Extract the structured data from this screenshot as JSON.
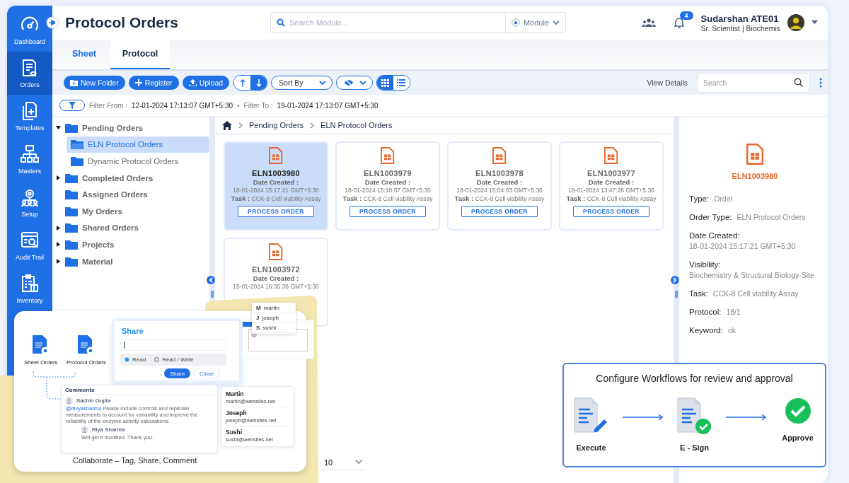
{
  "nav": [
    {
      "label": "Dashboard",
      "selected": false
    },
    {
      "label": "Orders",
      "selected": true
    },
    {
      "label": "Templates",
      "selected": false
    },
    {
      "label": "Masters",
      "selected": false
    },
    {
      "label": "Setup",
      "selected": false
    },
    {
      "label": "Audit Trail",
      "selected": false
    },
    {
      "label": "Inventory",
      "selected": false
    }
  ],
  "header": {
    "title": "Protocol Orders",
    "search": {
      "placeholder": "Search Module..."
    },
    "module": "Module",
    "notifications": "4",
    "user": {
      "name": "Sudarshan ATE01",
      "role": "Sr. Scientist | Biochemis"
    }
  },
  "tabs": [
    {
      "label": "Sheet",
      "selected": false
    },
    {
      "label": "Protocol",
      "selected": true
    }
  ],
  "toolbar": {
    "buttons": [
      {
        "label": "New Folder",
        "kind": "folder"
      },
      {
        "label": "Register",
        "kind": "plus"
      },
      {
        "label": "Upload",
        "kind": "upload"
      }
    ],
    "sort": "Sort By",
    "view_modes": [
      {
        "kind": "grid",
        "selected": true
      },
      {
        "kind": "list",
        "selected": false
      }
    ],
    "view_details": "View Details",
    "search": {
      "placeholder": "Search"
    }
  },
  "filter": {
    "from_label": "Filter From :",
    "from": "12-01-2024 17:13:07 GMT+5:30",
    "separator": "•",
    "to_label": "Filter To :",
    "to": "19-01-2024 17:13:07 GMT+5:30"
  },
  "tree": [
    {
      "label": "Pending Orders",
      "kind": "group",
      "expanded": true,
      "selected": false,
      "children": [
        {
          "label": "ELN Protocol Orders",
          "selected": true
        },
        {
          "label": "Dynamic Protocol Orders",
          "selected": false
        }
      ]
    },
    {
      "label": "Completed Orders",
      "kind": "group",
      "expanded": false,
      "selected": false
    },
    {
      "label": "Assigned Orders",
      "kind": "folder",
      "selected": false
    },
    {
      "label": "My Orders",
      "kind": "folder",
      "selected": false
    },
    {
      "label": "Shared Orders",
      "kind": "group",
      "expanded": false,
      "selected": false
    },
    {
      "label": "Projects",
      "kind": "group",
      "expanded": false,
      "selected": false
    },
    {
      "label": "Material",
      "kind": "group",
      "expanded": false,
      "selected": false
    }
  ],
  "breadcrumb": [
    "Pending Orders",
    "ELN Protocol Orders"
  ],
  "cards": [
    {
      "id": "ELN1003980",
      "date_label": "Date Created :",
      "date": "18-01-2024 15:17:21 GMT+5:30",
      "task_label": "Task :",
      "task": "CCK-8 Cell viability Assay",
      "action": "PROCESS ORDER",
      "selected": true
    },
    {
      "id": "ELN1003979",
      "date_label": "Date Created :",
      "date": "18-01-2024 15:10:57 GMT+5:30",
      "task_label": "Task :",
      "task": "CCK-8 Cell viability Assay",
      "action": "PROCESS ORDER",
      "selected": false
    },
    {
      "id": "ELN1003978",
      "date_label": "Date Created :",
      "date": "18-01-2024 15:04:03 GMT+5:30",
      "task_label": "Task :",
      "task": "CCK-8 Cell viability Assay",
      "action": "PROCESS ORDER",
      "selected": false
    },
    {
      "id": "ELN1003977",
      "date_label": "Date Created :",
      "date": "18-01-2024 13:47:26 GMT+5:30",
      "task_label": "Task :",
      "task": "CCK-8 Cell viability Assay",
      "action": "PROCESS ORDER",
      "selected": false
    },
    {
      "id": "ELN1003972",
      "date_label": "Date Created :",
      "date": "15-01-2024 16:35:36 GMT+5:30",
      "selected": false
    }
  ],
  "pager": {
    "page_size": "10"
  },
  "details": {
    "id": "ELN1003980",
    "fields": [
      {
        "label": "Type:",
        "value": "Order",
        "kind": "inline"
      },
      {
        "label": "Order Type:",
        "value": "ELN Protocol Orders",
        "kind": "inline"
      },
      {
        "label": "Date Created:",
        "value": "18-01-2024 15:17:21 GMT+5:30",
        "kind": "stacked"
      },
      {
        "label": "Visibility:",
        "value": "Biochemistry & Structural Biology-Site",
        "kind": "stacked"
      },
      {
        "label": "Task:",
        "value": "CCK-8 Cell viability Assay",
        "kind": "inline"
      },
      {
        "label": "Protocol:",
        "value": "18/1",
        "kind": "inline"
      },
      {
        "label": "Keyword:",
        "value": "ok",
        "kind": "inline"
      }
    ]
  },
  "collaborate": {
    "files": [
      "Sheet Orders",
      "Protocol Orders"
    ],
    "share": {
      "title": "Share",
      "options": [
        {
          "label": "Read",
          "selected": true
        },
        {
          "label": "Read / Write",
          "selected": false
        }
      ],
      "buttons": [
        "Share",
        "Close"
      ]
    },
    "editor_text": "@",
    "mentions": [
      {
        "initial": "M",
        "name": "martin"
      },
      {
        "initial": "J",
        "name": "joseph"
      },
      {
        "initial": "S",
        "name": "sushi"
      }
    ],
    "comments": {
      "title": "Comments",
      "items": [
        {
          "author": "Sachin Gupta",
          "mention": "@divyasharma",
          "text": " Please include controls and replicate measurements to account for variability and improve the reliability of the enzyme activity calculations."
        },
        {
          "author": "Riya Sharma",
          "text": "Will get it modified. Thank you."
        }
      ]
    },
    "contacts": [
      {
        "name": "Martin",
        "email": "martin@websites.net"
      },
      {
        "name": "Joseph",
        "email": "joseph@websites.net"
      },
      {
        "name": "Sushi",
        "email": "sushi@websites.net"
      }
    ],
    "caption": "Collaborate – Tag, Share, Comment"
  },
  "workflow": {
    "title": "Configure Workflows for review and approval",
    "steps": [
      {
        "label": "Execute",
        "kind": "execute"
      },
      {
        "label": "E - Sign",
        "kind": "sign"
      },
      {
        "label": "Approve",
        "kind": "approve"
      }
    ]
  }
}
